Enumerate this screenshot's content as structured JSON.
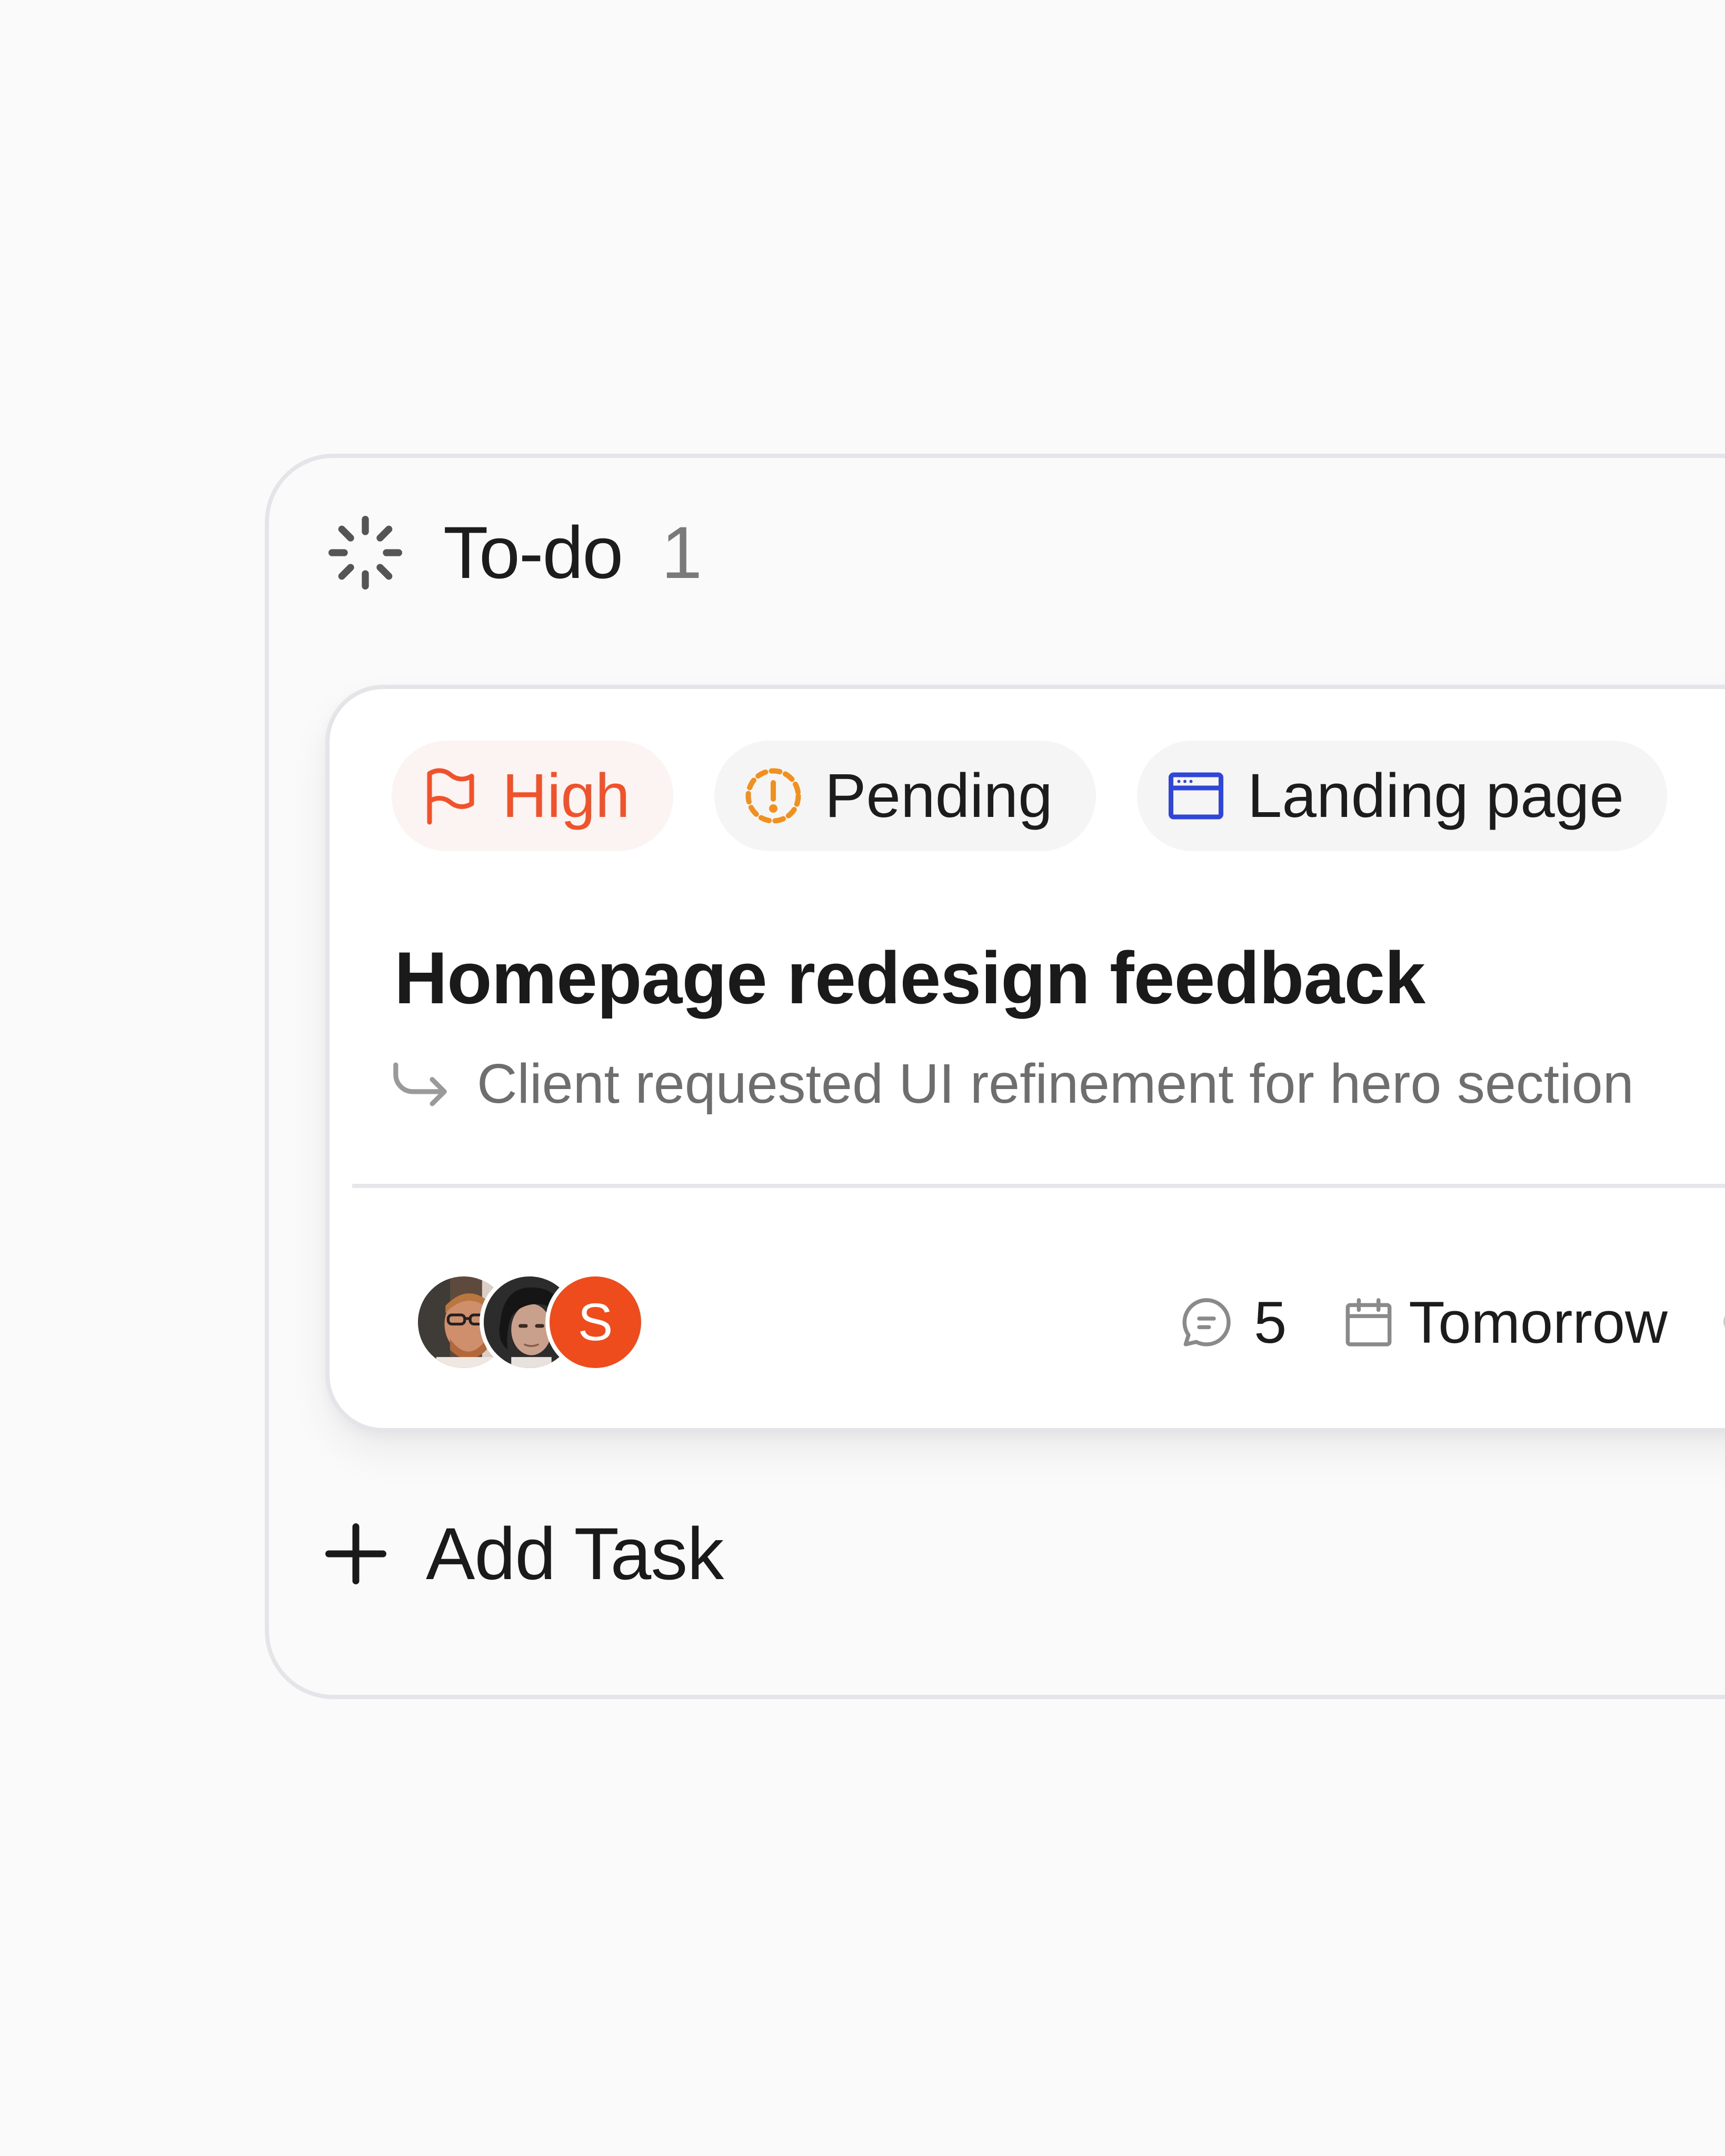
{
  "column": {
    "title": "To-do",
    "count": "1",
    "status_icon": "loader-icon"
  },
  "card": {
    "tags": [
      {
        "label": "High",
        "icon": "flag-icon",
        "color": "#f0532b"
      },
      {
        "label": "Pending",
        "icon": "alert-circle-icon",
        "color": "#f0901e"
      },
      {
        "label": "Landing page",
        "icon": "browser-window-icon",
        "color": "#2f46d8"
      }
    ],
    "title": "Homepage redesign feedback",
    "subtask": "Client requested UI refinement for hero section",
    "assignees": [
      {
        "name": "avatar-photo-1"
      },
      {
        "name": "avatar-photo-2"
      },
      {
        "initial": "S",
        "color": "#ee4c1c"
      }
    ],
    "comments": "5",
    "due": "Tomorrow"
  },
  "add_task": {
    "label": "Add Task"
  }
}
